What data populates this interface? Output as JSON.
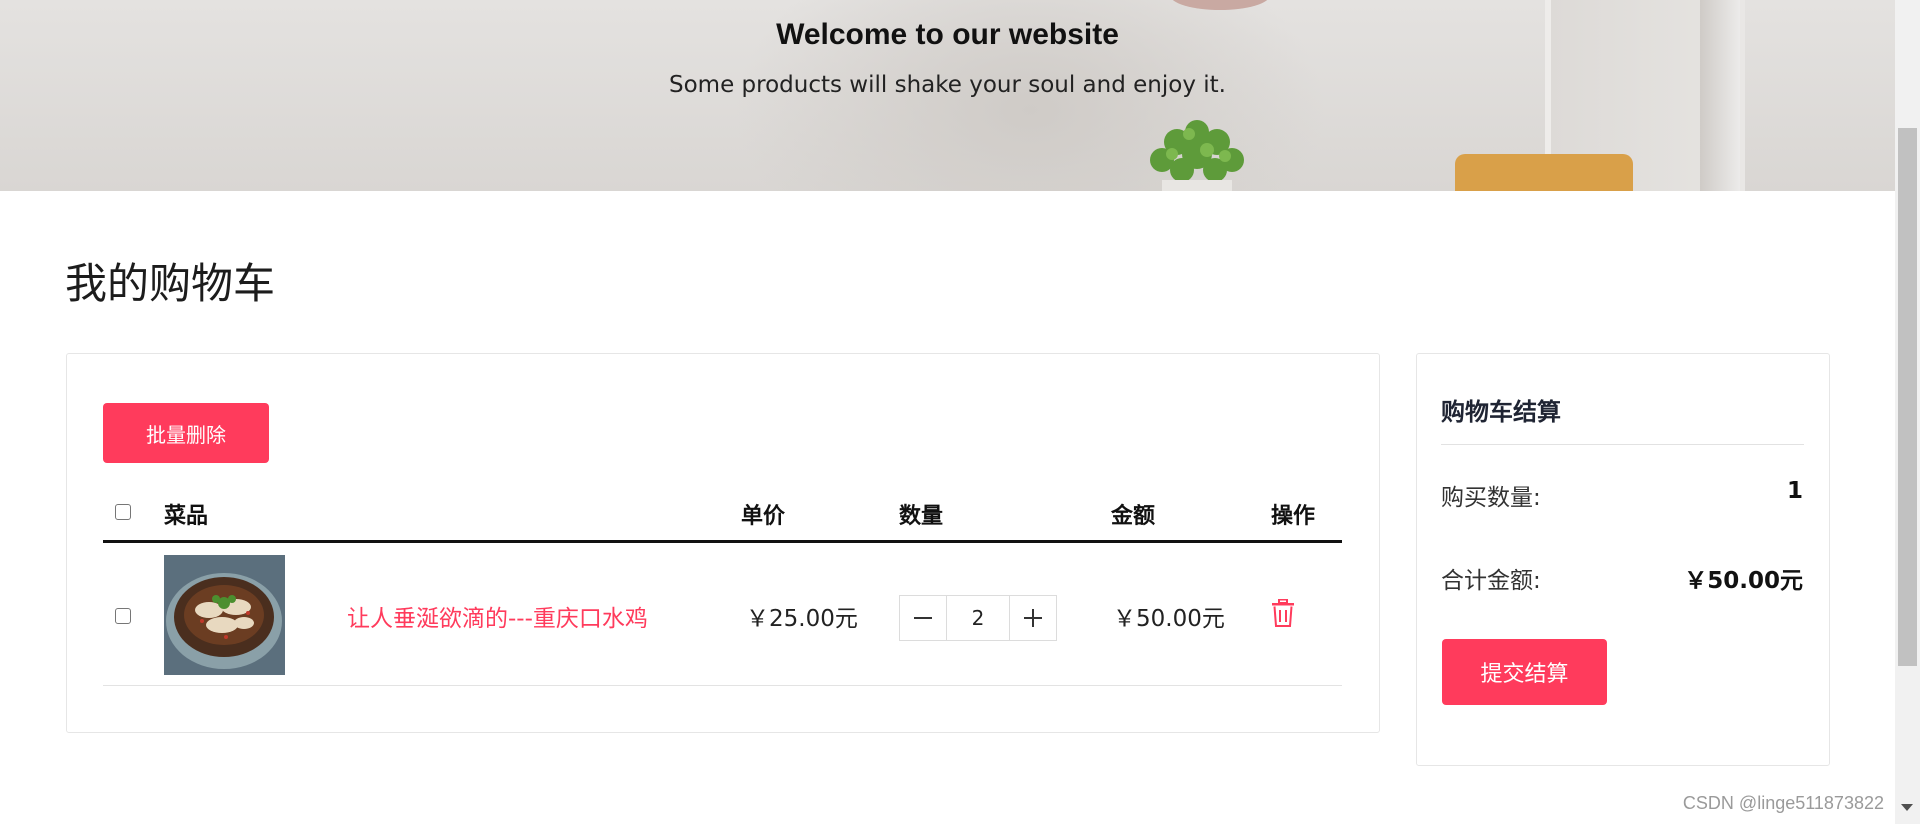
{
  "hero": {
    "title": "Welcome to our website",
    "subtitle": "Some products will shake your soul and enjoy it."
  },
  "page": {
    "title": "我的购物车"
  },
  "cart": {
    "batch_delete_label": "批量删除",
    "columns": {
      "dish": "菜品",
      "unit_price": "单价",
      "quantity": "数量",
      "amount": "金额",
      "action": "操作"
    },
    "items": [
      {
        "name": "让人垂涎欲滴的---重庆口水鸡",
        "unit_price": "￥25.00元",
        "quantity": "2",
        "amount": "￥50.00元",
        "image": "dish-image"
      }
    ],
    "decrement_symbol": "—",
    "increment_symbol": "+"
  },
  "summary": {
    "title": "购物车结算",
    "count_label": "购买数量:",
    "count_value": "1",
    "total_label": "合计金额:",
    "total_value": "￥50.00元",
    "checkout_label": "提交结算"
  },
  "watermark": "CSDN @linge511873822",
  "colors": {
    "accent": "#ff3b5c",
    "text_dark": "#1f2433",
    "border": "#e6e6e6"
  },
  "icons": {
    "delete": "trash-icon",
    "minus": "minus-icon",
    "plus": "plus-icon"
  }
}
